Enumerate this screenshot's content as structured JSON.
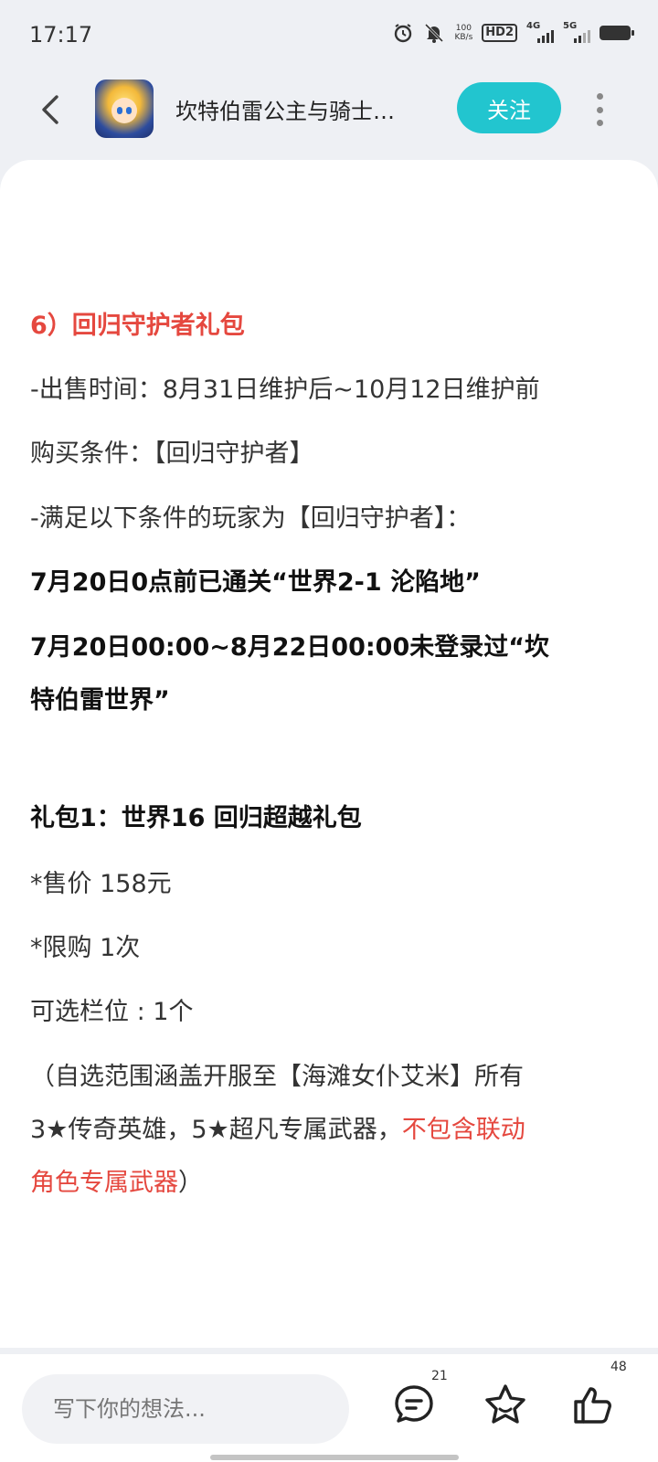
{
  "status_bar": {
    "time": "17:17",
    "net_speed_top": "100",
    "net_speed_bottom": "KB/s",
    "hd_label": "HD2",
    "sig1_label": "4G",
    "sig2_label": "5G",
    "icons": [
      "alarm-icon",
      "mute-bell-icon",
      "battery-icon"
    ]
  },
  "header": {
    "title": "坎特伯雷公主与骑士…",
    "follow_label": "关注"
  },
  "article": {
    "lines": [
      {
        "text": "6）回归守护者礼包"
      },
      {
        "text": "-出售时间：8月31日维护后~10月12日维护前"
      },
      {
        "text": "购买条件：【回归守护者】"
      },
      {
        "text": "-满足以下条件的玩家为【回归守护者】："
      },
      {
        "text": "7月20日0点前已通关“世界2-1 沦陷地”"
      },
      {
        "text": "7月20日00:00~8月22日00:00未登录过“坎"
      },
      {
        "text": "特伯雷世界”"
      },
      {
        "text": "礼包1：世界16 回归超越礼包"
      },
      {
        "text": "*售价 158元"
      },
      {
        "text": "*限购 1次"
      },
      {
        "text": "可选栏位 : 1个"
      },
      {
        "text": "（自选范围涵盖开服至【海滩女仆艾米】所有"
      },
      {
        "text_a": "3★传奇英雄，5★超凡专属武器，",
        "text_b": "不包含联动"
      },
      {
        "text_a": "角色专属武器",
        "text_b": "）"
      }
    ]
  },
  "bottom_bar": {
    "comment_placeholder": "写下你的想法...",
    "comment_count": "21",
    "like_count": "48"
  },
  "colors": {
    "accent": "#22c5cf",
    "highlight_red": "#e5483f"
  }
}
